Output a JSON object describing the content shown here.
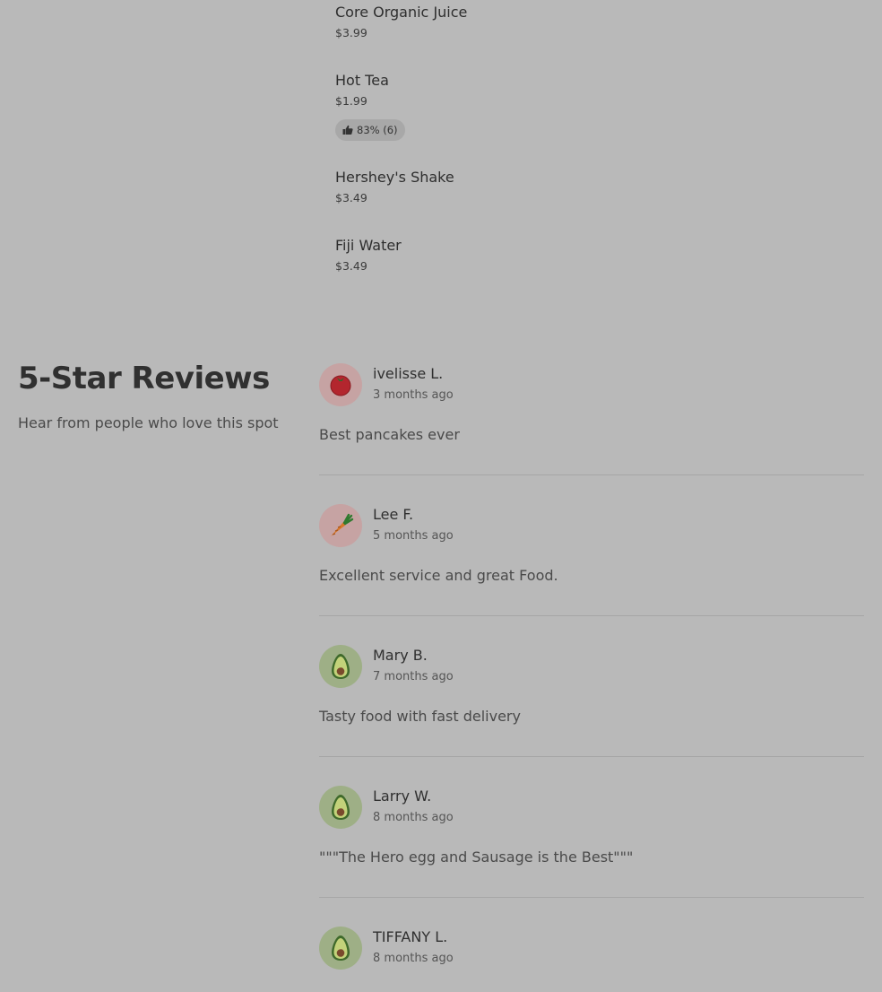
{
  "menu": {
    "items": [
      {
        "name": "Core Organic Juice",
        "price": "$3.99"
      },
      {
        "name": "Hot Tea",
        "price": "$1.99",
        "rating": "83% (6)"
      },
      {
        "name": "Hershey's Shake",
        "price": "$3.49"
      },
      {
        "name": "Fiji Water",
        "price": "$3.49"
      }
    ]
  },
  "reviews": {
    "title": "5-Star Reviews",
    "subtitle": "Hear from people who love this spot",
    "items": [
      {
        "author": "ivelisse L.",
        "time": "3 months ago",
        "text": "Best pancakes ever",
        "avatar": "tomato-icon"
      },
      {
        "author": "Lee F.",
        "time": "5 months ago",
        "text": "Excellent service and great Food.",
        "avatar": "carrot-icon"
      },
      {
        "author": "Mary B.",
        "time": "7 months ago",
        "text": "Tasty food with fast delivery",
        "avatar": "avocado-icon"
      },
      {
        "author": "Larry W.",
        "time": "8 months ago",
        "text": "\"\"\"The Hero egg and Sausage is the Best\"\"\"",
        "avatar": "avocado-icon"
      },
      {
        "author": "TIFFANY L.",
        "time": "8 months ago",
        "text": "",
        "avatar": "avocado-icon"
      }
    ]
  }
}
